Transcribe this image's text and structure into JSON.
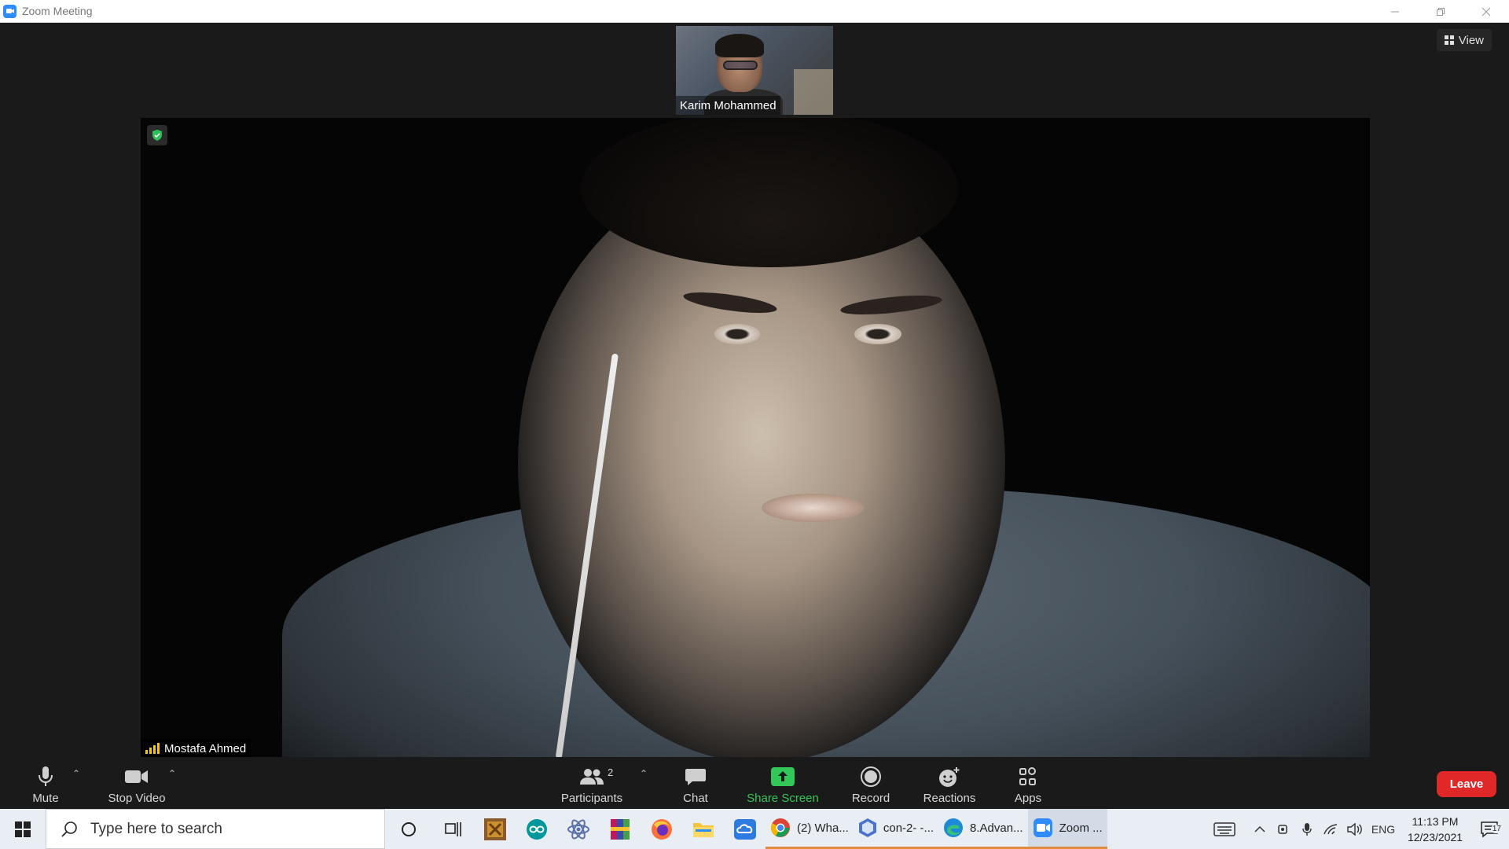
{
  "window": {
    "title": "Zoom Meeting"
  },
  "thumbnail": {
    "participant_name": "Karim Mohammed"
  },
  "view_button": {
    "label": "View"
  },
  "main_video": {
    "speaker_name": "Mostafa Ahmed"
  },
  "controls": {
    "mute_label": "Mute",
    "stop_video_label": "Stop Video",
    "participants_label": "Participants",
    "participants_count": "2",
    "chat_label": "Chat",
    "share_screen_label": "Share Screen",
    "record_label": "Record",
    "reactions_label": "Reactions",
    "apps_label": "Apps",
    "leave_label": "Leave"
  },
  "taskbar": {
    "search_placeholder": "Type here to search",
    "apps": [
      {
        "label": "(2) Wha...",
        "icon": "chrome-icon"
      },
      {
        "label": "con-2- -...",
        "icon": "virtualbox-icon"
      },
      {
        "label": "8.Advan...",
        "icon": "edge-icon"
      },
      {
        "label": "Zoom ...",
        "icon": "zoom-icon"
      }
    ],
    "language": "ENG",
    "time": "11:13 PM",
    "date": "12/23/2021",
    "notification_count": "17"
  },
  "colors": {
    "share_green": "#33c759",
    "leave_red": "#e02828",
    "zoom_blue": "#2d8cff"
  }
}
